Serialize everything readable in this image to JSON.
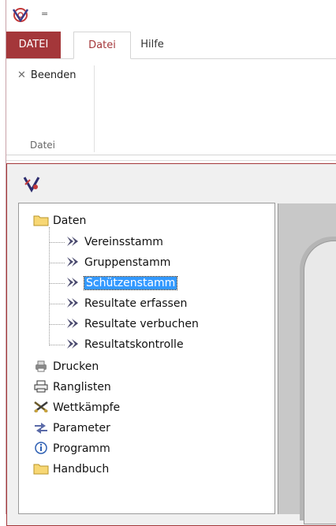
{
  "titlebar": {
    "qat_arrow": "="
  },
  "ribbon": {
    "tabs": [
      {
        "label": "DATEI"
      },
      {
        "label": "Datei"
      },
      {
        "label": "Hilfe"
      }
    ],
    "buttons": {
      "beenden": "Beenden"
    },
    "group_label": "Datei"
  },
  "nav": {
    "selected": "Schützenstamm",
    "items": [
      {
        "label": "Daten",
        "icon": "folder-icon"
      },
      {
        "label": "Vereinsstamm",
        "icon": "chevron-arrow-icon"
      },
      {
        "label": "Gruppenstamm",
        "icon": "chevron-arrow-icon"
      },
      {
        "label": "Schützenstamm",
        "icon": "chevron-arrow-icon"
      },
      {
        "label": "Resultate erfassen",
        "icon": "chevron-arrow-icon"
      },
      {
        "label": "Resultate verbuchen",
        "icon": "chevron-arrow-icon"
      },
      {
        "label": "Resultatskontrolle",
        "icon": "chevron-arrow-icon"
      },
      {
        "label": "Drucken",
        "icon": "printer-icon"
      },
      {
        "label": "Ranglisten",
        "icon": "print-list-icon"
      },
      {
        "label": "Wettkämpfe",
        "icon": "crossed-rifles-icon"
      },
      {
        "label": "Parameter",
        "icon": "settings-arrows-icon"
      },
      {
        "label": "Programm",
        "icon": "info-icon"
      },
      {
        "label": "Handbuch",
        "icon": "folder-icon"
      }
    ]
  },
  "colors": {
    "accent": "#a4373a",
    "selection": "#3399ff",
    "content_bg": "#c8c8c8"
  }
}
